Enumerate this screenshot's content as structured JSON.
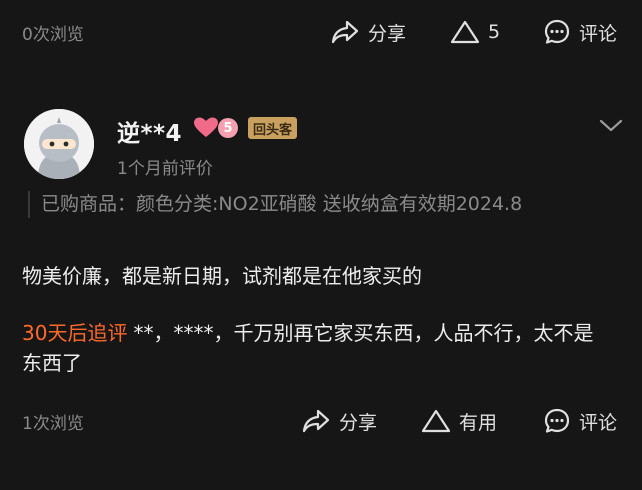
{
  "top_bar": {
    "views": "0次浏览",
    "share_label": "分享",
    "like_count": "5",
    "comment_label": "评论"
  },
  "review": {
    "username": "逆**4",
    "level": "5",
    "badge": "回头客",
    "time": "1个月前评价",
    "purchased": "已购商品：颜色分类:NO2亚硝酸 送收纳盒有效期2024.8",
    "content": "物美价廉，都是新日期，试剂都是在他家买的",
    "followup_tag": "30天后追评",
    "followup_text": "**，****，千万别再它家买东西，人品不行，太不是东西了"
  },
  "bottom_bar": {
    "views": "1次浏览",
    "share_label": "分享",
    "like_label": "有用",
    "comment_label": "评论"
  },
  "icons": {
    "share": "share-arrow-icon",
    "like": "triangle-thumb-icon",
    "comment": "chat-bubble-icon",
    "expand": "chevron-down-icon",
    "level": "heart-icon"
  },
  "colors": {
    "background": "#161616",
    "accent": "#ff6a2b",
    "badge": "#c8a060",
    "heart": "#f06a8a"
  }
}
